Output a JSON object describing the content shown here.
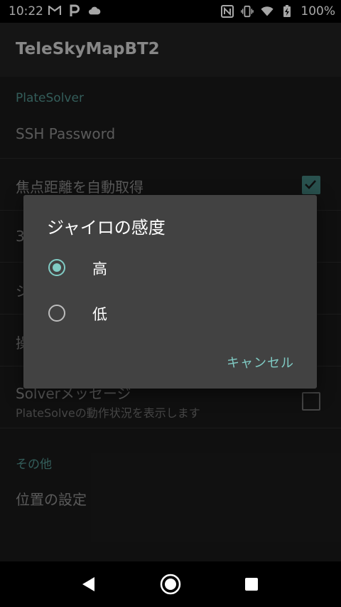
{
  "status_bar": {
    "time": "10:22",
    "battery_text": "100%",
    "icons": [
      "gmail-icon",
      "parking-icon",
      "cloud-icon",
      "nfc-icon",
      "vibrate-icon",
      "wifi-icon",
      "battery-charging-icon"
    ]
  },
  "app_bar": {
    "title": "TeleSkyMapBT2"
  },
  "settings": {
    "category_platesolver": "PlateSolver",
    "ssh_password": "SSH Password",
    "focal_auto": "焦点距離を自動取得",
    "row3_partial": "3",
    "row4_partial": "ジ",
    "row5_partial": "操",
    "solver_message": "Solverメッセージ",
    "solver_message_summary": "PlateSolveの動作状況を表示します",
    "category_other": "その他",
    "location": "位置の設定"
  },
  "dialog": {
    "title": "ジャイロの感度",
    "options": [
      {
        "label": "高",
        "selected": true
      },
      {
        "label": "低",
        "selected": false
      }
    ],
    "cancel": "キャンセル"
  },
  "colors": {
    "accent": "#80cbc4",
    "dialog_bg": "#424242",
    "background": "#1a1a1a"
  }
}
